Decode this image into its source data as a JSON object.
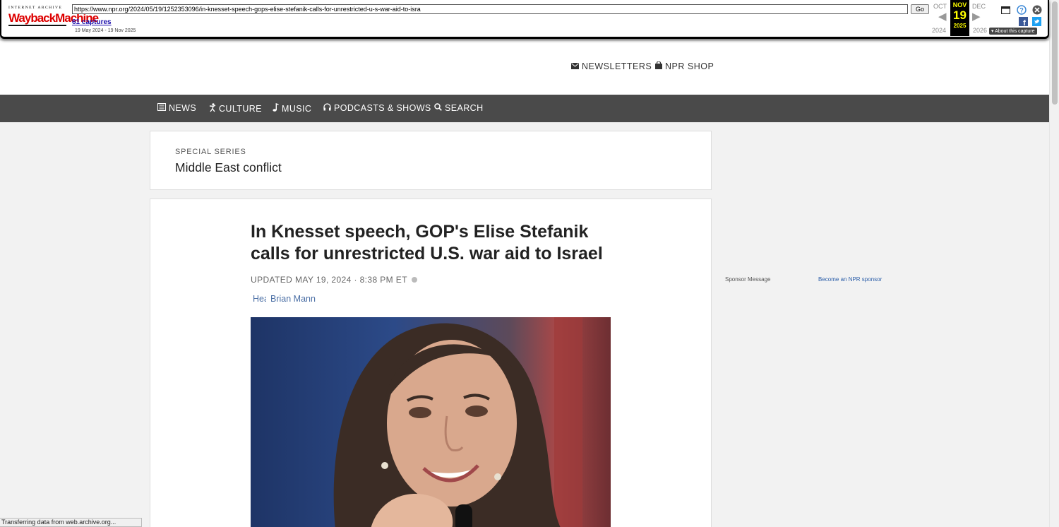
{
  "wayback": {
    "logo_small": "INTERNET ARCHIVE",
    "logo_main": "WaybackMachine",
    "url": "https://www.npr.org/2024/05/19/1252353096/in-knesset-speech-gops-elise-stefanik-calls-for-unrestricted-u-s-war-aid-to-isra",
    "go_label": "Go",
    "captures_link": "61 captures",
    "date_range": "19 May 2024 - 19 Nov 2025",
    "prev_month": "OCT",
    "cur_month": "NOV",
    "next_month": "DEC",
    "prev_year": "2024",
    "cur_day": "19",
    "cur_year": "2025",
    "next_year": "2026",
    "about_label": "▾ About this capture"
  },
  "header": {
    "newsletters": "NEWSLETTERS",
    "shop": "NPR SHOP"
  },
  "nav": {
    "news": "NEWS",
    "culture": "CULTURE",
    "music": "MUSIC",
    "podcasts": "PODCASTS & SHOWS",
    "search": "SEARCH"
  },
  "series": {
    "label": "SPECIAL SERIES",
    "title": "Middle East conflict"
  },
  "article": {
    "headline": "In Knesset speech, GOP's Elise Stefanik calls for unrestricted U.S. war aid to Israel",
    "updated": "UPDATED MAY 19, 2024 · 8:38 PM ET",
    "byline_cut": "Hea",
    "author": "Brian Mann"
  },
  "sidebar": {
    "sponsor_label": "Sponsor Message",
    "sponsor_link": "Become an NPR sponsor"
  },
  "status": {
    "text": "Transferring data from web.archive.org..."
  },
  "colors": {
    "nav_bg": "#4a4a4a",
    "wayback_red": "#dd0000",
    "current_highlight": "#ffff00",
    "link_blue": "#4b6fa5"
  }
}
